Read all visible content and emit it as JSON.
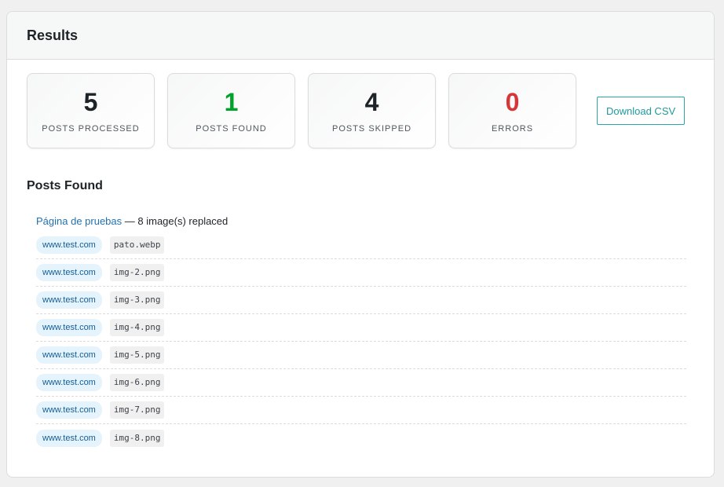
{
  "header": {
    "title": "Results"
  },
  "stats": [
    {
      "value": "5",
      "label": "POSTS PROCESSED",
      "color": "#1d2327"
    },
    {
      "value": "1",
      "label": "POSTS FOUND",
      "color": "#00a32a"
    },
    {
      "value": "4",
      "label": "POSTS SKIPPED",
      "color": "#1d2327"
    },
    {
      "value": "0",
      "label": "ERRORS",
      "color": "#d63638"
    }
  ],
  "actions": {
    "download_csv_label": "Download CSV"
  },
  "section": {
    "title": "Posts Found"
  },
  "post": {
    "title": "Página de pruebas",
    "summary": " — 8 image(s) replaced",
    "images": [
      {
        "domain": "www.test.com",
        "file": "pato.webp"
      },
      {
        "domain": "www.test.com",
        "file": "img-2.png"
      },
      {
        "domain": "www.test.com",
        "file": "img-3.png"
      },
      {
        "domain": "www.test.com",
        "file": "img-4.png"
      },
      {
        "domain": "www.test.com",
        "file": "img-5.png"
      },
      {
        "domain": "www.test.com",
        "file": "img-6.png"
      },
      {
        "domain": "www.test.com",
        "file": "img-7.png"
      },
      {
        "domain": "www.test.com",
        "file": "img-8.png"
      }
    ]
  }
}
